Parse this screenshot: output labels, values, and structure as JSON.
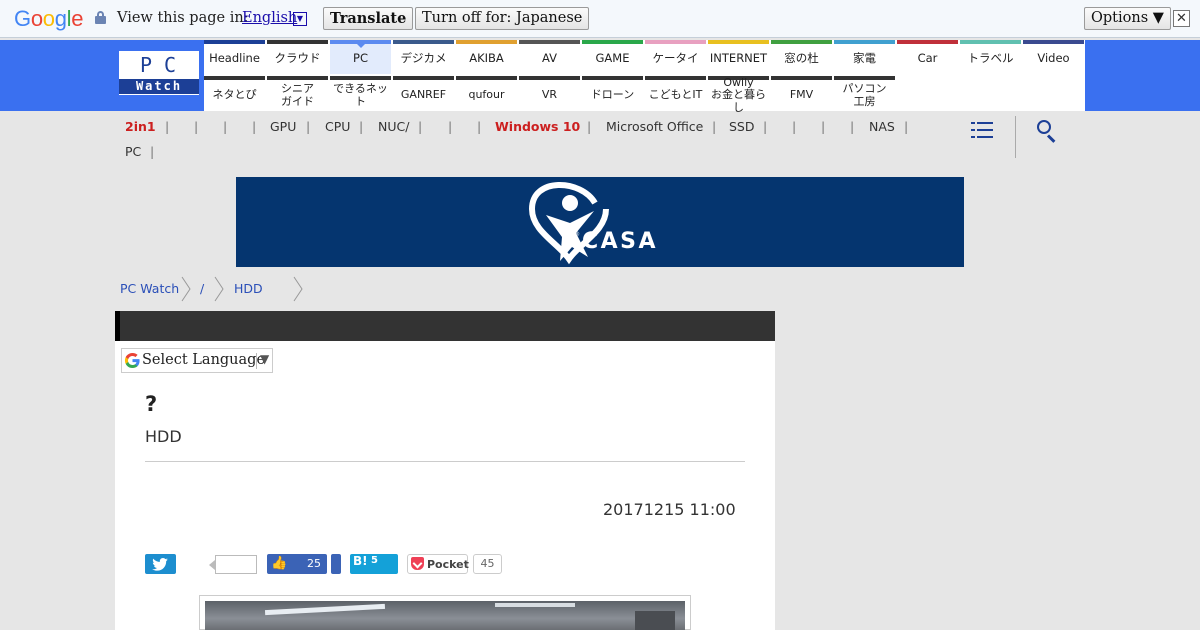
{
  "translate_bar": {
    "logo_letters": [
      {
        "ch": "G",
        "color": "#4285f4"
      },
      {
        "ch": "o",
        "color": "#ea4335"
      },
      {
        "ch": "o",
        "color": "#fbbc05"
      },
      {
        "ch": "g",
        "color": "#4285f4"
      },
      {
        "ch": "l",
        "color": "#34a853"
      },
      {
        "ch": "e",
        "color": "#ea4335"
      }
    ],
    "label": "View this page in:",
    "language": "English",
    "language_arrow": "▼",
    "translate_button": "Translate",
    "turn_off_button": "Turn off for: Japanese",
    "options_button": "Options ▼",
    "close_symbol": "✕"
  },
  "header": {
    "logo_top": "PC",
    "logo_bottom": "Watch",
    "nav_row1": [
      {
        "label": "Headline",
        "color": "#1c3f96"
      },
      {
        "label": "クラウド",
        "color": "#333333"
      },
      {
        "label": "PC",
        "color": "#5b8af0",
        "active": true
      },
      {
        "label": "デジカメ",
        "color": "#3a5a8c"
      },
      {
        "label": "AKIBA",
        "color": "#e0a030"
      },
      {
        "label": "AV",
        "color": "#555555"
      },
      {
        "label": "GAME",
        "color": "#2aa84a"
      },
      {
        "label": "ケータイ",
        "color": "#e8a0c0"
      },
      {
        "label": "INTERNET",
        "color": "#e8c020"
      },
      {
        "label": "窓の杜",
        "color": "#40a040"
      },
      {
        "label": "家電",
        "color": "#40a0d0"
      },
      {
        "label": "Car",
        "color": "#c0303a"
      },
      {
        "label": "トラベル",
        "color": "#60c0b0"
      },
      {
        "label": "Video",
        "color": "#3a4a90"
      }
    ],
    "nav_row2": [
      {
        "label": "ネタとぴ",
        "color": "#333333"
      },
      {
        "label": "シニア\nガイド",
        "color": "#333333"
      },
      {
        "label": "できるネット",
        "color": "#333333"
      },
      {
        "label": "GANREF",
        "color": "#333333"
      },
      {
        "label": "qufour",
        "color": "#333333"
      },
      {
        "label": "VR",
        "color": "#333333"
      },
      {
        "label": "ドローン",
        "color": "#333333"
      },
      {
        "label": "こどもとIT",
        "color": "#333333"
      },
      {
        "label": "Owlly\nお金と暮らし",
        "color": "#333333"
      },
      {
        "label": "FMV",
        "color": "#333333"
      },
      {
        "label": "パソコン\n工房",
        "color": "#333333"
      }
    ]
  },
  "tags": [
    {
      "label": "2in1",
      "red": true
    },
    {
      "label": "GPU"
    },
    {
      "label": "CPU"
    },
    {
      "label": "NUC/"
    },
    {
      "label": "Windows 10",
      "red": true
    },
    {
      "label": "Microsoft Office"
    },
    {
      "label": "SSD"
    },
    {
      "label": "NAS"
    },
    {
      "label": "PC"
    }
  ],
  "banner": {
    "text": "CASA",
    "reg": "®"
  },
  "breadcrumb": [
    "PC Watch",
    "/",
    "HDD"
  ],
  "article": {
    "select_language": "Select Language",
    "select_arrow": "▼",
    "title": "?",
    "subtitle": "HDD",
    "date": "20171215 11:00"
  },
  "social": {
    "like_count": "25",
    "hatena_mark": "B!",
    "hatena_count": "5",
    "pocket_label": "Pocket",
    "pocket_count": "45"
  }
}
